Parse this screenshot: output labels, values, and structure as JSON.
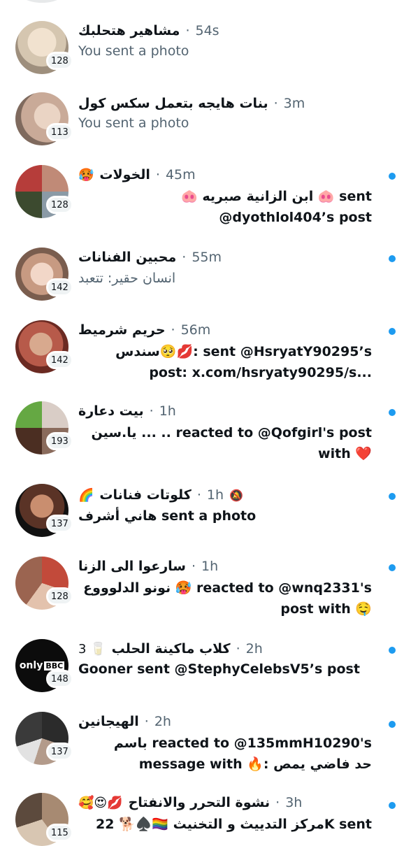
{
  "colors": {
    "unread_dot": "#1d9bf0",
    "muted_text": "#536471",
    "badge_bg": "#eff3f4"
  },
  "conversations": [
    {
      "name": "مشاهير هتحلبك",
      "time": "54s",
      "preview": "You sent a photo",
      "badge": "128",
      "unread": false
    },
    {
      "name": "بنات هايجه بتعمل سكس كول",
      "time": "3m",
      "preview": "You sent a photo",
      "badge": "113",
      "unread": false
    },
    {
      "name": "الخولات",
      "name_emoji": "🥵",
      "time": "45m",
      "preview": "🐽 ابن الزانية صبريه 🐽 sent @dyothlol404’s post",
      "badge": "128",
      "unread": true
    },
    {
      "name": "محبين الفنانات",
      "time": "55m",
      "preview": "انسان حقير: تتعبد",
      "badge": "142",
      "unread": true
    },
    {
      "name": "حريم شرميط",
      "time": "56m",
      "preview": "سندس🥺💋: sent @HsryatY90295’s post: x.com/hsryaty90295/s...",
      "badge": "142",
      "unread": true
    },
    {
      "name": "بيت دعارة",
      "time": "1h",
      "preview": "يا.سين ... .. reacted to @Qofgirl's post with ❤️",
      "badge": "193",
      "unread": true
    },
    {
      "name": "كلوتات فنانات",
      "name_emoji": "🌈",
      "time": "1h",
      "muted_icon": "🔕",
      "preview": "هاني أشرف sent a photo",
      "badge": "137",
      "unread": true
    },
    {
      "name": "سارعوا الى الزنا",
      "time": "1h",
      "preview": "نونو الدلوووع 🥵 reacted to @wnq2331's post with 🤤",
      "badge": "128",
      "unread": true
    },
    {
      "name": "كلاب ماكينة الحلب",
      "name_emoji": "3 🥛",
      "time": "2h",
      "preview": "Gooner sent @StephyCelebsV5’s post",
      "badge": "148",
      "unread": true
    },
    {
      "name": "الهيجانين",
      "time": "2h",
      "preview": "باسم reacted to @135mmH10290's message with 🔥: حد فاضي يمص",
      "badge": "137",
      "unread": true
    },
    {
      "name": "نشوة التحرر والانفتاح",
      "name_emoji": "🥰😍💋",
      "time": "3h",
      "preview": "مركز التدييث و التخنيث 🏳️‍🌈♠️🐕 22K sent",
      "badge": "115",
      "unread": true
    }
  ]
}
